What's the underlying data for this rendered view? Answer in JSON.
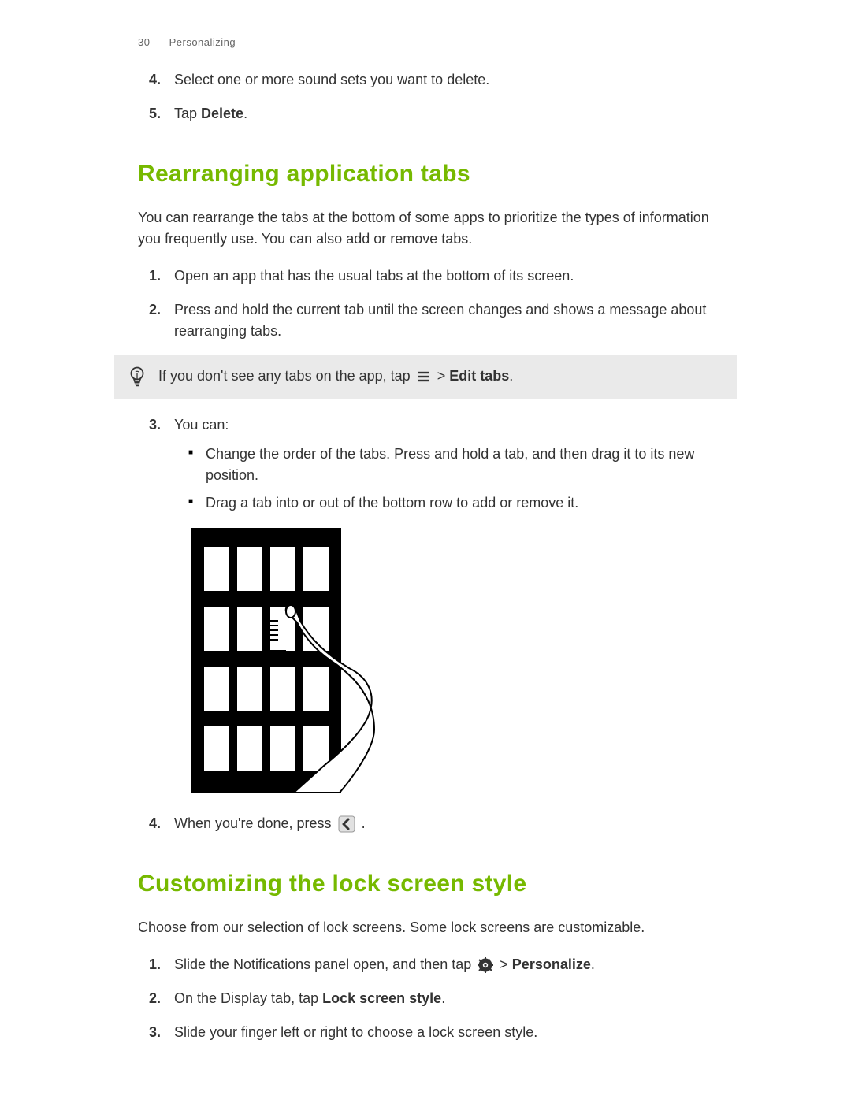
{
  "header": {
    "page_number": "30",
    "section": "Personalizing"
  },
  "top_steps": {
    "s4": {
      "num": "4.",
      "text": "Select one or more sound sets you want to delete."
    },
    "s5": {
      "num": "5.",
      "pre": "Tap ",
      "bold": "Delete",
      "post": "."
    }
  },
  "section1": {
    "title": "Rearranging application tabs",
    "intro": "You can rearrange the tabs at the bottom of some apps to prioritize the types of information you frequently use. You can also add or remove tabs.",
    "steps": {
      "s1": {
        "num": "1.",
        "text": "Open an app that has the usual tabs at the bottom of its screen."
      },
      "s2": {
        "num": "2.",
        "text": "Press and hold the current tab until the screen changes and shows a message about rearranging tabs."
      }
    },
    "tip": {
      "pre": "If you don't see any tabs on the app, tap ",
      "breadcrumb_sep": " > ",
      "bold": "Edit tabs",
      "post": "."
    },
    "s3": {
      "num": "3.",
      "text": "You can:"
    },
    "bullets": {
      "b1": "Change the order of the tabs. Press and hold a tab, and then drag it to its new position.",
      "b2": "Drag a tab into or out of the bottom row to add or remove it."
    },
    "s4": {
      "num": "4.",
      "pre": "When you're done, press ",
      "post": " ."
    }
  },
  "section2": {
    "title": "Customizing the lock screen style",
    "intro": "Choose from our selection of lock screens. Some lock screens are customizable.",
    "steps": {
      "s1": {
        "num": "1.",
        "pre": "Slide the Notifications panel open, and then tap ",
        "sep": " > ",
        "bold": "Personalize",
        "post": "."
      },
      "s2": {
        "num": "2.",
        "pre": "On the Display tab, tap ",
        "bold": "Lock screen style",
        "post": "."
      },
      "s3": {
        "num": "3.",
        "text": "Slide your finger left or right to choose a lock screen style."
      }
    }
  }
}
